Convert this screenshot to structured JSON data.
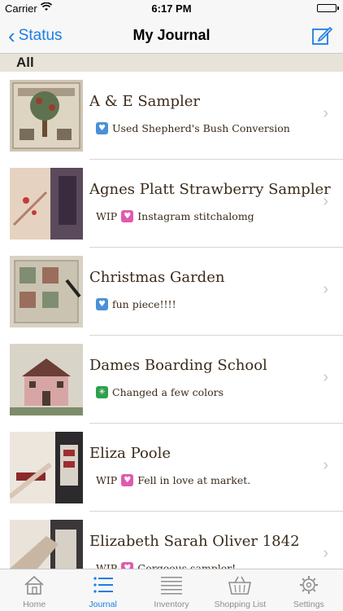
{
  "status_bar": {
    "carrier": "Carrier",
    "time": "6:17 PM"
  },
  "nav": {
    "back_label": "Status",
    "title": "My Journal"
  },
  "section": {
    "title": "All"
  },
  "rows": [
    {
      "title": "A & E Sampler",
      "prefix": "",
      "badge": "blue",
      "badge_glyph": "♥",
      "note": "Used Shepherd's Bush Conversion"
    },
    {
      "title": "Agnes Platt Strawberry Sampler",
      "prefix": "WIP",
      "badge": "pink",
      "badge_glyph": "♥",
      "note": "Instagram stitchalomg"
    },
    {
      "title": "Christmas Garden",
      "prefix": "",
      "badge": "blue",
      "badge_glyph": "♥",
      "note": "fun piece!!!!"
    },
    {
      "title": "Dames Boarding School",
      "prefix": "",
      "badge": "green",
      "badge_glyph": "✳",
      "note": "Changed a few colors"
    },
    {
      "title": "Eliza Poole",
      "prefix": "WIP",
      "badge": "pink",
      "badge_glyph": "♥",
      "note": "Fell in love at market."
    },
    {
      "title": "Elizabeth Sarah Oliver 1842",
      "prefix": "WIP",
      "badge": "pink",
      "badge_glyph": "♥",
      "note": "Gorgeous sampler!"
    }
  ],
  "tabs": [
    {
      "label": "Home",
      "icon": "home-icon"
    },
    {
      "label": "Journal",
      "icon": "list-icon"
    },
    {
      "label": "Inventory",
      "icon": "lines-icon"
    },
    {
      "label": "Shopping List",
      "icon": "basket-icon"
    },
    {
      "label": "Settings",
      "icon": "gear-icon"
    }
  ],
  "active_tab": "Journal",
  "colors": {
    "accent": "#1b7ee6",
    "section_bg": "#e8e3d8",
    "text_brown": "#3a2a1a"
  }
}
